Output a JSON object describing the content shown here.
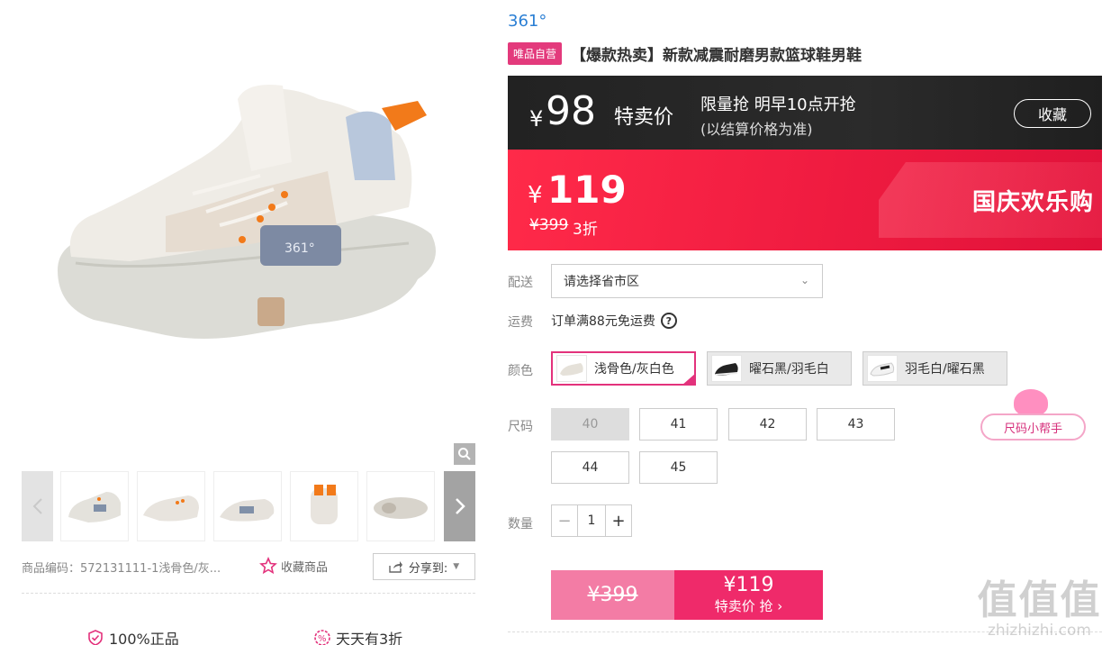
{
  "gallery": {
    "thumbnails": [
      "thumb-1",
      "thumb-2",
      "thumb-3",
      "thumb-4",
      "thumb-5"
    ],
    "sku_code": "商品编码：572131111-1浅骨色/灰...",
    "favorite_label": "收藏商品",
    "share_label": "分享到:",
    "guarantees": [
      "100%正品",
      "天天有3折"
    ]
  },
  "product": {
    "brand": "361°",
    "badge": "唯品自营",
    "title": "【爆款热卖】新款减震耐磨男款篮球鞋男鞋"
  },
  "flash_price": {
    "yen": "¥",
    "price": "98",
    "label": "特卖价",
    "line1": "限量抢 明早10点开抢",
    "line2": "(以结算价格为准)",
    "favorite": "收藏"
  },
  "current_price": {
    "yen": "¥",
    "price": "119",
    "original": "¥399",
    "discount": "3折",
    "promo": "国庆欢乐购"
  },
  "delivery": {
    "label": "配送",
    "placeholder": "请选择省市区"
  },
  "shipping": {
    "label": "运费",
    "text": "订单满88元免运费",
    "help": "?"
  },
  "colors": {
    "label": "颜色",
    "options": [
      "浅骨色/灰白色",
      "曜石黑/羽毛白",
      "羽毛白/曜石黑"
    ],
    "selected_index": 0
  },
  "sizes": {
    "label": "尺码",
    "options": [
      "40",
      "41",
      "42",
      "43",
      "44",
      "45"
    ],
    "disabled": [
      "40"
    ],
    "helper": "尺码小帮手"
  },
  "quantity": {
    "label": "数量",
    "value": "1",
    "minus": "−",
    "plus": "+"
  },
  "buy": {
    "original": "¥399",
    "price": "¥119",
    "label": "特卖价 抢 ›"
  },
  "watermark": {
    "big": "值值值",
    "small": "zhizhizhi.com"
  },
  "colors_theme": {
    "brand_blue": "#2b7fd4",
    "accent_pink": "#e3327c",
    "promo_red": "#ef1b40"
  }
}
